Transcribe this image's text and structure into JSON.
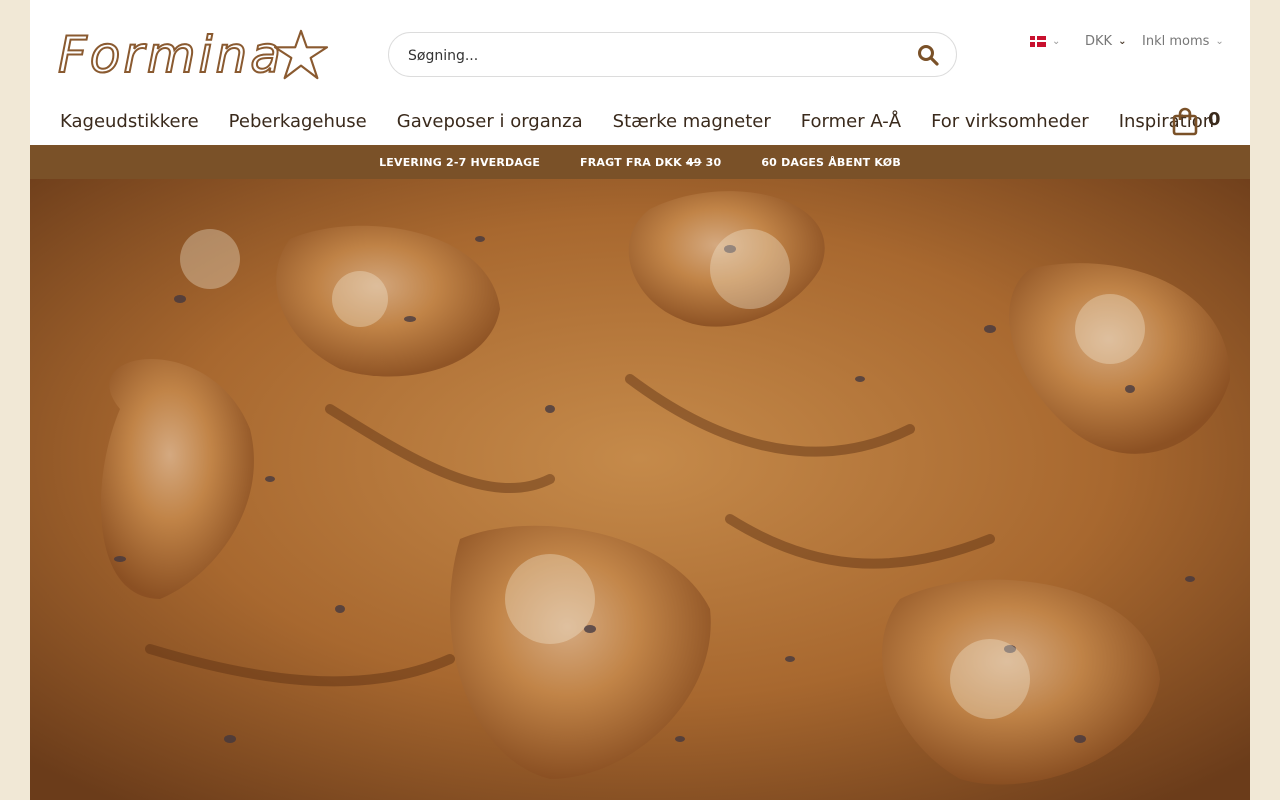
{
  "brand": {
    "logo_text": "Formina"
  },
  "search": {
    "placeholder": "Søgning..."
  },
  "top_controls": {
    "language": "DK",
    "currency": "DKK",
    "vat": "Inkl moms"
  },
  "nav": {
    "items": [
      "Kageudstikkere",
      "Peberkagehuse",
      "Gaveposer i organza",
      "Stærke magneter",
      "Former A-Å",
      "For virksomheder",
      "Inspiration"
    ]
  },
  "cart": {
    "count": "0"
  },
  "info_strip": {
    "delivery": "LEVERING 2-7 HVERDAGE",
    "shipping_prefix": "FRAGT FRA DKK",
    "shipping_old": "49",
    "shipping_new": "30",
    "returns": "60 DAGES ÅBENT KØB"
  },
  "colors": {
    "brand_brown": "#7a5128",
    "background": "#f1e8d6",
    "text": "#3a2a1c"
  }
}
